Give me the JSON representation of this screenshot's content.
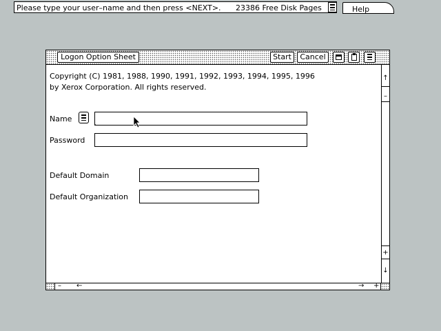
{
  "message_bar": {
    "prompt": "Please type your user–name and then press <NEXT>.",
    "disk_pages": "23386 Free Disk Pages"
  },
  "help_tab": {
    "label": "Help"
  },
  "window": {
    "title": "Logon Option Sheet",
    "buttons": {
      "start": "Start",
      "cancel": "Cancel"
    }
  },
  "copyright": {
    "line1": "Copyright (C) 1981, 1988, 1990, 1991, 1992, 1993, 1994, 1995, 1996",
    "line2": "by Xerox Corporation.  All rights reserved."
  },
  "form": {
    "name_label": "Name",
    "name_value": "",
    "password_label": "Password",
    "password_value": "",
    "domain_label": "Default Domain",
    "domain_value": "",
    "organization_label": "Default Organization",
    "organization_value": ""
  },
  "scroll": {
    "up": "↑",
    "minus": "–",
    "plus": "+",
    "down": "↓",
    "left": "←",
    "right": "→"
  },
  "icons": {
    "menu": "menu-lines-icon",
    "cursor": "arrow-pointer-icon"
  }
}
